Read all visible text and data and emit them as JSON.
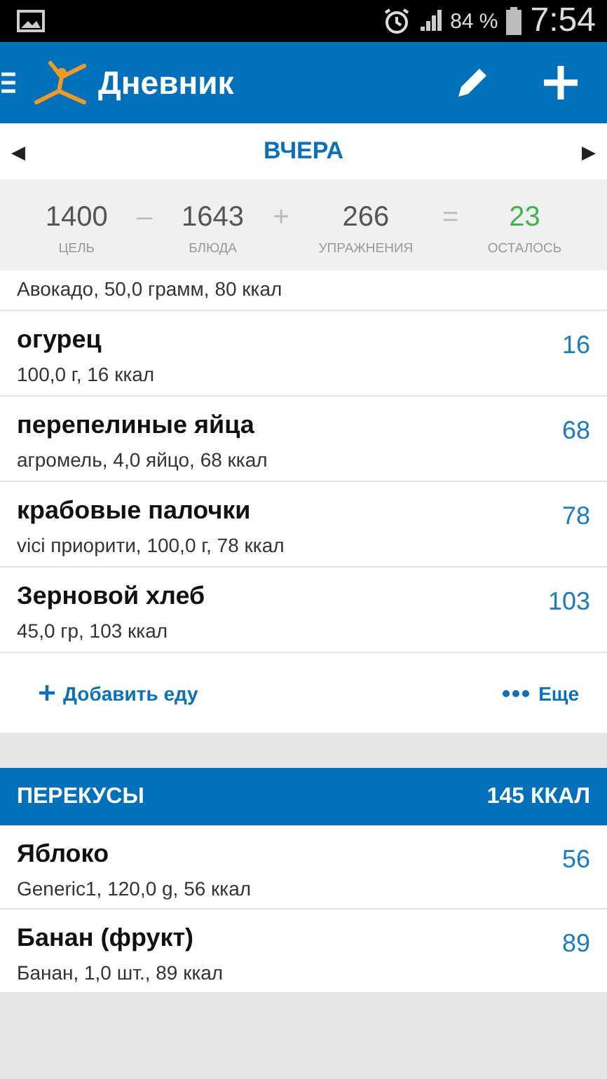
{
  "status_bar": {
    "battery": "84 %",
    "time": "7:54"
  },
  "app_bar": {
    "title": "Дневник"
  },
  "date_nav": {
    "prev": "◀",
    "label": "ВЧЕРА",
    "next": "▶"
  },
  "summary": [
    {
      "value": "1400",
      "label": "ЦЕЛЬ",
      "kind": "number"
    },
    {
      "value": "–",
      "kind": "operator"
    },
    {
      "value": "1643",
      "label": "БЛЮДА",
      "kind": "number"
    },
    {
      "value": "+",
      "kind": "operator"
    },
    {
      "value": "266",
      "label": "УПРАЖНЕНИЯ",
      "kind": "number"
    },
    {
      "value": "=",
      "kind": "operator"
    },
    {
      "value": "23",
      "label": "ОСТАЛОСЬ",
      "kind": "result"
    }
  ],
  "meal_entries_partial": {
    "detail": "Авокадо, 50,0 грамм, 80 ккал"
  },
  "meal_entries": [
    {
      "name": "огурец",
      "detail": "100,0 г, 16 ккал",
      "calories": "16"
    },
    {
      "name": "перепелиные яйца",
      "detail": "агромель, 4,0 яйцо, 68 ккал",
      "calories": "68"
    },
    {
      "name": "крабовые палочки",
      "detail": "vici приорити, 100,0 г, 78 ккал",
      "calories": "78"
    },
    {
      "name": "Зерновой хлеб",
      "detail": "45,0 гр, 103 ккал",
      "calories": "103"
    }
  ],
  "meal_actions": {
    "add": "Добавить еду",
    "more": "Еще"
  },
  "snacks": {
    "title": "ПЕРЕКУСЫ",
    "total": "145 ККАЛ",
    "entries": [
      {
        "name": "Яблоко",
        "detail": "Generic1, 120,0 g, 56 ккал",
        "calories": "56"
      },
      {
        "name": "Банан (фрукт)",
        "detail": "Банан, 1,0 шт., 89 ккал",
        "calories": "89"
      }
    ]
  }
}
